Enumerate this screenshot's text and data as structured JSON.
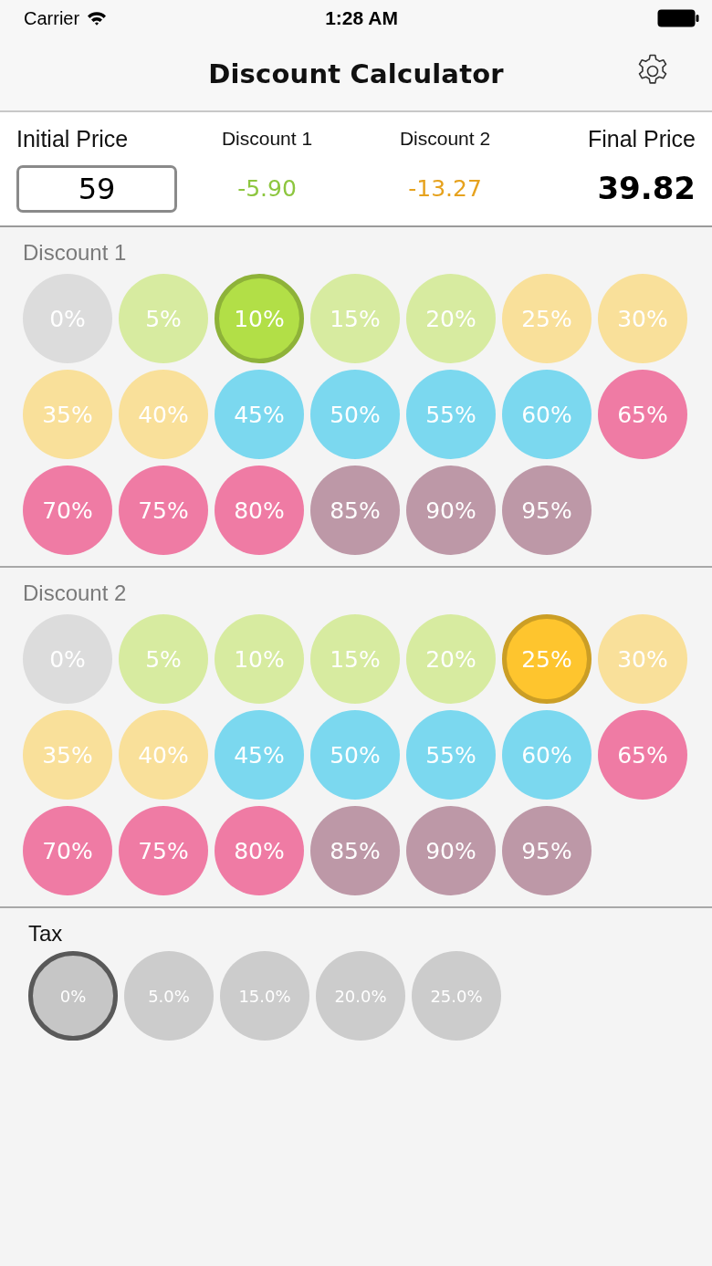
{
  "status_bar": {
    "carrier": "Carrier",
    "time": "1:28 AM"
  },
  "nav_bar": {
    "title": "Discount Calculator"
  },
  "summary": [
    {
      "kind": "input",
      "label": "Initial Price",
      "value": "59"
    },
    {
      "kind": "amount",
      "label": "Discount 1",
      "value": "-5.90",
      "color": "#8dc63f"
    },
    {
      "kind": "amount",
      "label": "Discount 2",
      "value": "-13.27",
      "color": "#e6a21e"
    },
    {
      "kind": "total",
      "label": "Final Price",
      "value": "39.82"
    }
  ],
  "sections": [
    {
      "kind": "discount",
      "title": "Discount 1",
      "options": [
        {
          "label": "0%",
          "color": "#dcdcdc",
          "selected": false
        },
        {
          "label": "5%",
          "color": "#d7eba0",
          "selected": false
        },
        {
          "label": "10%",
          "color": "#b2df47",
          "selected": true
        },
        {
          "label": "15%",
          "color": "#d7eba0",
          "selected": false
        },
        {
          "label": "20%",
          "color": "#d7eba0",
          "selected": false
        },
        {
          "label": "25%",
          "color": "#f9e09a",
          "selected": false
        },
        {
          "label": "30%",
          "color": "#f9e09a",
          "selected": false
        },
        {
          "label": "35%",
          "color": "#f9e09a",
          "selected": false
        },
        {
          "label": "40%",
          "color": "#f9e09a",
          "selected": false
        },
        {
          "label": "45%",
          "color": "#7bd8ef",
          "selected": false
        },
        {
          "label": "50%",
          "color": "#7bd8ef",
          "selected": false
        },
        {
          "label": "55%",
          "color": "#7bd8ef",
          "selected": false
        },
        {
          "label": "60%",
          "color": "#7bd8ef",
          "selected": false
        },
        {
          "label": "65%",
          "color": "#ef7ba4",
          "selected": false
        },
        {
          "label": "70%",
          "color": "#ef7ba4",
          "selected": false
        },
        {
          "label": "75%",
          "color": "#ef7ba4",
          "selected": false
        },
        {
          "label": "80%",
          "color": "#ef7ba4",
          "selected": false
        },
        {
          "label": "85%",
          "color": "#bd98a7",
          "selected": false
        },
        {
          "label": "90%",
          "color": "#bd98a7",
          "selected": false
        },
        {
          "label": "95%",
          "color": "#bd98a7",
          "selected": false
        }
      ]
    },
    {
      "kind": "discount",
      "title": "Discount 2",
      "options": [
        {
          "label": "0%",
          "color": "#dcdcdc",
          "selected": false
        },
        {
          "label": "5%",
          "color": "#d7eba0",
          "selected": false
        },
        {
          "label": "10%",
          "color": "#d7eba0",
          "selected": false
        },
        {
          "label": "15%",
          "color": "#d7eba0",
          "selected": false
        },
        {
          "label": "20%",
          "color": "#d7eba0",
          "selected": false
        },
        {
          "label": "25%",
          "color": "#fec52e",
          "selected": true
        },
        {
          "label": "30%",
          "color": "#f9e09a",
          "selected": false
        },
        {
          "label": "35%",
          "color": "#f9e09a",
          "selected": false
        },
        {
          "label": "40%",
          "color": "#f9e09a",
          "selected": false
        },
        {
          "label": "45%",
          "color": "#7bd8ef",
          "selected": false
        },
        {
          "label": "50%",
          "color": "#7bd8ef",
          "selected": false
        },
        {
          "label": "55%",
          "color": "#7bd8ef",
          "selected": false
        },
        {
          "label": "60%",
          "color": "#7bd8ef",
          "selected": false
        },
        {
          "label": "65%",
          "color": "#ef7ba4",
          "selected": false
        },
        {
          "label": "70%",
          "color": "#ef7ba4",
          "selected": false
        },
        {
          "label": "75%",
          "color": "#ef7ba4",
          "selected": false
        },
        {
          "label": "80%",
          "color": "#ef7ba4",
          "selected": false
        },
        {
          "label": "85%",
          "color": "#bd98a7",
          "selected": false
        },
        {
          "label": "90%",
          "color": "#bd98a7",
          "selected": false
        },
        {
          "label": "95%",
          "color": "#bd98a7",
          "selected": false
        }
      ]
    },
    {
      "kind": "tax",
      "title": "Tax",
      "options": [
        {
          "label": "0%",
          "color": "#c6c6c6",
          "selected": true
        },
        {
          "label": "5.0%",
          "color": "#cccccc",
          "selected": false
        },
        {
          "label": "15.0%",
          "color": "#cccccc",
          "selected": false
        },
        {
          "label": "20.0%",
          "color": "#cccccc",
          "selected": false
        },
        {
          "label": "25.0%",
          "color": "#cccccc",
          "selected": false
        }
      ]
    }
  ]
}
